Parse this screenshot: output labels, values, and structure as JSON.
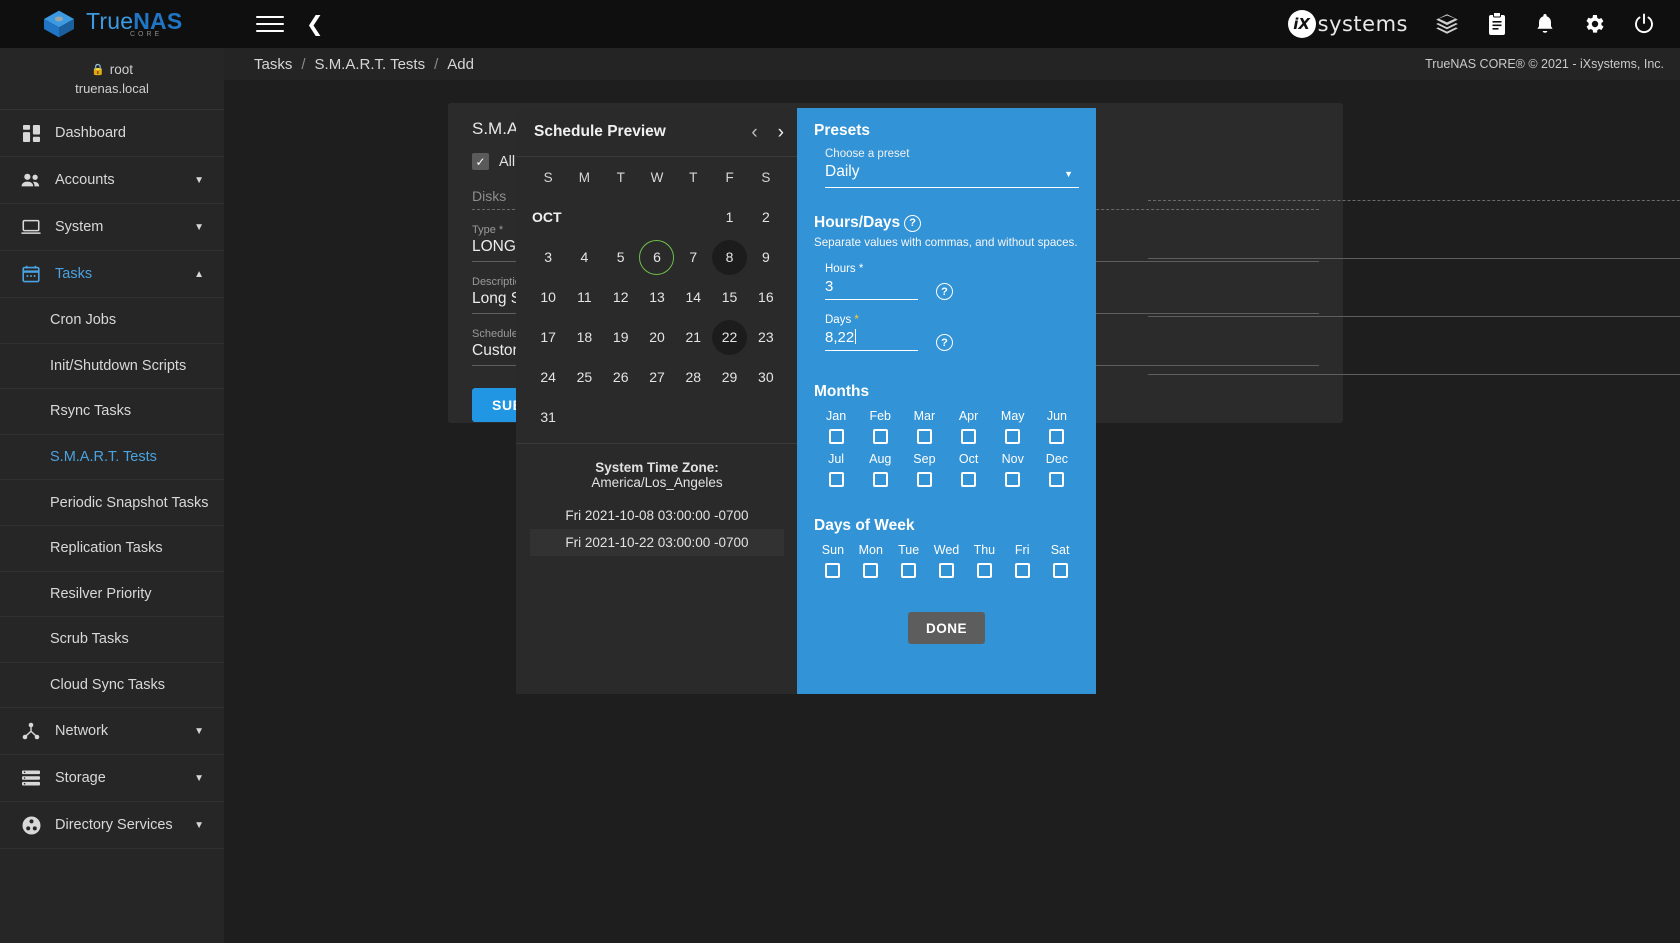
{
  "app": {
    "brand_true": "True",
    "brand_nas": "NAS",
    "brand_sub": "CORE",
    "vendor": "systems",
    "vendor_mark": "iX"
  },
  "topbar": {
    "menu_icon": "hamburger-icon",
    "back_icon": "chevron-left-icon",
    "icons": [
      "layers-icon",
      "clipboard-icon",
      "bell-icon",
      "gear-icon",
      "power-icon"
    ]
  },
  "breadcrumb": {
    "items": [
      "Tasks",
      "S.M.A.R.T. Tests",
      "Add"
    ],
    "separator": "/",
    "copyright": "TrueNAS CORE® © 2021 - iXsystems, Inc."
  },
  "sidebar": {
    "user": "root",
    "host": "truenas.local",
    "items": [
      {
        "label": "Dashboard",
        "icon": "dashboard-icon",
        "caret": "",
        "active": false
      },
      {
        "label": "Accounts",
        "icon": "accounts-icon",
        "caret": "▼",
        "active": false
      },
      {
        "label": "System",
        "icon": "system-icon",
        "caret": "▼",
        "active": false
      },
      {
        "label": "Tasks",
        "icon": "tasks-calendar-icon",
        "caret": "▲",
        "active": true
      }
    ],
    "sub_items": [
      {
        "label": "Cron Jobs",
        "active": false
      },
      {
        "label": "Init/Shutdown Scripts",
        "active": false
      },
      {
        "label": "Rsync Tasks",
        "active": false
      },
      {
        "label": "S.M.A.R.T. Tests",
        "active": true
      },
      {
        "label": "Periodic Snapshot Tasks",
        "active": false
      },
      {
        "label": "Replication Tasks",
        "active": false
      },
      {
        "label": "Resilver Priority",
        "active": false
      },
      {
        "label": "Scrub Tasks",
        "active": false
      },
      {
        "label": "Cloud Sync Tasks",
        "active": false
      }
    ],
    "items_after": [
      {
        "label": "Network",
        "icon": "network-icon",
        "caret": "▼",
        "active": false
      },
      {
        "label": "Storage",
        "icon": "storage-icon",
        "caret": "▼",
        "active": false
      },
      {
        "label": "Directory Services",
        "icon": "directory-services-icon",
        "caret": "▼",
        "active": false
      }
    ]
  },
  "form": {
    "title": "S.M.A.R.",
    "all_disks_label": "All Dis",
    "check_glyph": "✓",
    "fields": [
      {
        "label": "Disks",
        "value": ""
      },
      {
        "label": "Type *",
        "value": "LONG"
      },
      {
        "label": "Description",
        "value": "Long SMAI"
      },
      {
        "label": "Schedule *",
        "value": "Custom ("
      }
    ],
    "submit_label": "SUBMI"
  },
  "schedule_preview": {
    "title": "Schedule Preview",
    "prev_icon": "chevron-left-icon",
    "next_icon": "chevron-right-icon",
    "prev_glyph": "‹",
    "next_glyph": "›",
    "dow_headers": [
      "S",
      "M",
      "T",
      "W",
      "T",
      "F",
      "S"
    ],
    "month_tag": "OCT",
    "weeks": [
      [
        "OCT",
        "",
        "",
        "",
        "",
        "1",
        "2"
      ],
      [
        "3",
        "4",
        "5",
        "6",
        "7",
        "8",
        "9"
      ],
      [
        "10",
        "11",
        "12",
        "13",
        "14",
        "15",
        "16"
      ],
      [
        "17",
        "18",
        "19",
        "20",
        "21",
        "22",
        "23"
      ],
      [
        "24",
        "25",
        "26",
        "27",
        "28",
        "29",
        "30"
      ],
      [
        "31",
        "",
        "",
        "",
        "",
        "",
        ""
      ]
    ],
    "today": "6",
    "selected_days": [
      "8",
      "22"
    ],
    "timezone_label": "System Time Zone:",
    "timezone_value": "America/Los_Angeles",
    "runs": [
      "Fri 2021-10-08 03:00:00 -0700",
      "Fri 2021-10-22 03:00:00 -0700"
    ]
  },
  "presets": {
    "heading": "Presets",
    "choose_label": "Choose a preset",
    "choose_value": "Daily",
    "caret_glyph": "▼",
    "hours_days_heading": "Hours/Days",
    "help_glyph": "?",
    "hint": "Separate values with commas, and without spaces.",
    "hours_label": "Hours",
    "hours_value": "3",
    "days_label": "Days",
    "days_value": "8,22",
    "required_glyph": "*",
    "months_heading": "Months",
    "months": [
      "Jan",
      "Feb",
      "Mar",
      "Apr",
      "May",
      "Jun",
      "Jul",
      "Aug",
      "Sep",
      "Oct",
      "Nov",
      "Dec"
    ],
    "months_checked": [],
    "dow_heading": "Days of Week",
    "days_of_week": [
      "Sun",
      "Mon",
      "Tue",
      "Wed",
      "Thu",
      "Fri",
      "Sat"
    ],
    "dow_checked": [],
    "done_label": "DONE",
    "accent": "#3293d6"
  }
}
